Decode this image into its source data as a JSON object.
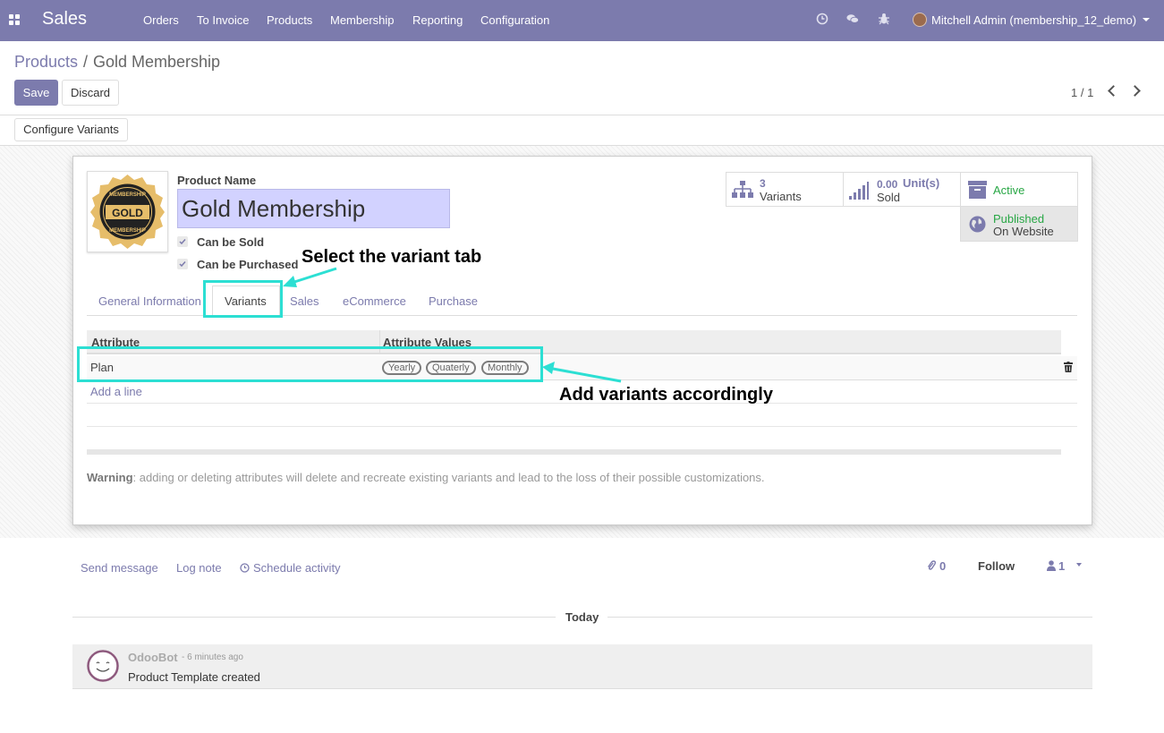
{
  "navbar": {
    "app_name": "Sales",
    "menu": [
      "Orders",
      "To Invoice",
      "Products",
      "Membership",
      "Reporting",
      "Configuration"
    ],
    "user": "Mitchell Admin (membership_12_demo)",
    "icons": [
      "clock-icon",
      "chat-icon",
      "bug-icon"
    ]
  },
  "breadcrumb": {
    "parent": "Products",
    "separator": "/",
    "current": "Gold Membership"
  },
  "buttons": {
    "save": "Save",
    "discard": "Discard",
    "configure_variants": "Configure Variants"
  },
  "pager": {
    "value": "1 / 1"
  },
  "product": {
    "name_label": "Product Name",
    "name": "Gold Membership",
    "image_text": {
      "top": "MEMBERSHIP",
      "center": "GOLD",
      "bottom": "MEMBERSHIP"
    },
    "can_be_sold": "Can be Sold",
    "can_be_purchased": "Can be Purchased"
  },
  "smart_buttons": {
    "variants_count": "3",
    "variants_label": "Variants",
    "sold_value": "0.00",
    "sold_unit": "Unit(s)",
    "sold_label": "Sold",
    "active_label": "Active",
    "published_label": "Published",
    "published_sub": "On Website"
  },
  "tabs": [
    "General Information",
    "Variants",
    "Sales",
    "eCommerce",
    "Purchase"
  ],
  "attributes_table": {
    "headers": [
      "Attribute",
      "Attribute Values"
    ],
    "rows": [
      {
        "attribute": "Plan",
        "values": [
          "Yearly",
          "Quaterly",
          "Monthly"
        ]
      }
    ],
    "add_line": "Add a line"
  },
  "warning": {
    "label": "Warning",
    "text": ": adding or deleting attributes will delete and recreate existing variants and lead to the loss of their possible customizations."
  },
  "annotations": {
    "select_tab": "Select the variant tab",
    "add_variants": "Add variants accordingly",
    "color": "#2cdfd3"
  },
  "chatter": {
    "send_message": "Send message",
    "log_note": "Log note",
    "schedule_activity": "Schedule activity",
    "attachments": "0",
    "follow": "Follow",
    "followers": "1",
    "date_separator": "Today",
    "message": {
      "author": "OdooBot",
      "time": "- 6 minutes ago",
      "body": "Product Template created"
    }
  },
  "colors": {
    "brand": "#7c7bad",
    "active": "#28a745"
  }
}
